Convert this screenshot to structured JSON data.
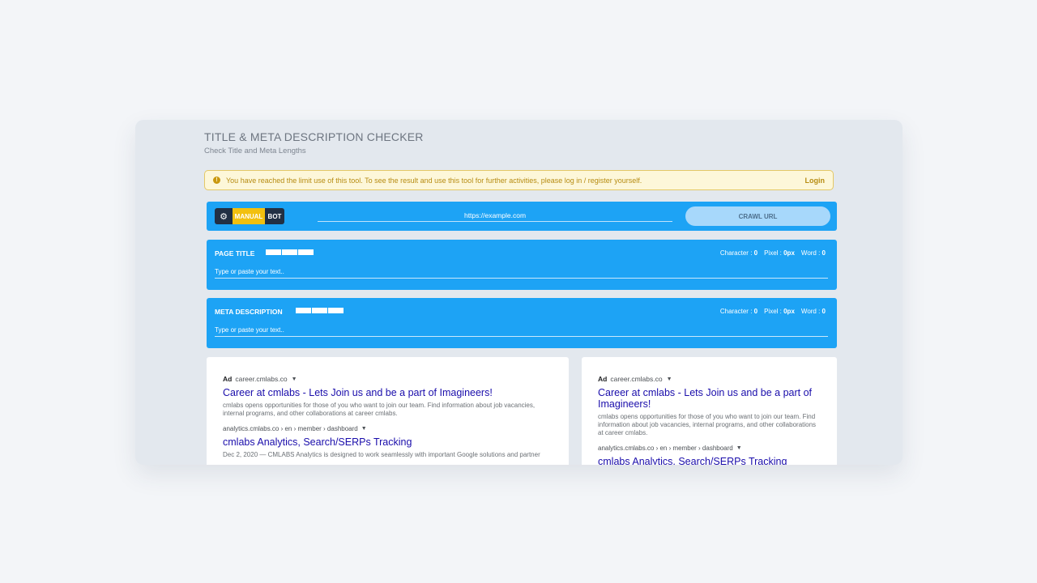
{
  "header": {
    "title": "TITLE & META DESCRIPTION CHECKER",
    "subtitle": "Check Title and Meta Lengths"
  },
  "alert": {
    "message": "You have reached the limit use of this tool. To see the result and use this tool for further activities, please log in / register yourself.",
    "login_label": "Login",
    "icon": "exclamation-circle-icon"
  },
  "crawl": {
    "mode_icon": "gear-icon",
    "mode_manual": "MANUAL",
    "mode_bot": "BOT",
    "active_mode": "MANUAL",
    "url_placeholder": "https://example.com",
    "button_label": "CRAWL URL"
  },
  "page_title": {
    "label": "PAGE TITLE",
    "char_label": "Character : ",
    "char_value": "0",
    "pixel_label": "Pixel : ",
    "pixel_value": "0px",
    "word_label": "Word : ",
    "word_value": "0",
    "placeholder": "Type or paste your text.."
  },
  "meta_description": {
    "label": "META DESCRIPTION",
    "char_label": "Character : ",
    "char_value": "0",
    "pixel_label": "Pixel : ",
    "pixel_value": "0px",
    "word_label": "Word : ",
    "word_value": "0",
    "placeholder": "Type or paste your text.."
  },
  "preview_desktop": {
    "ad_tag": "Ad",
    "ad_domain": "career.cmlabs.co",
    "ad_title": "Career at cmlabs - Lets Join us and be a part of Imagineers!",
    "ad_desc": "cmlabs opens opportunities for those of you who want to join our team. Find information about job vacancies, internal programs, and other collaborations at career cmlabs.",
    "result_url": "analytics.cmlabs.co › en › member › dashboard",
    "result_title": "cmlabs Analytics, Search/SERPs Tracking",
    "result_desc": "Dec 2, 2020 — CMLABS Analytics is designed to work seamlessly with important Google solutions and partner"
  },
  "preview_mobile": {
    "ad_tag": "Ad",
    "ad_domain": "career.cmlabs.co",
    "ad_title": "Career at cmlabs - Lets Join us and be a part of Imagineers!",
    "ad_desc": "cmlabs opens opportunities for those of you who want to join our team. Find information about job vacancies, internal programs, and other collaborations at career cmlabs.",
    "result_url": "analytics.cmlabs.co › en › member › dashboard",
    "result_title": "cmlabs Analytics, Search/SERPs Tracking"
  },
  "colors": {
    "panel_blue": "#1da3f5",
    "manual_yellow": "#f2c00f",
    "dark_navy": "#223044",
    "alert_bg": "#fdf7d9",
    "alert_text": "#b78c12",
    "serp_link": "#1a0dab"
  }
}
